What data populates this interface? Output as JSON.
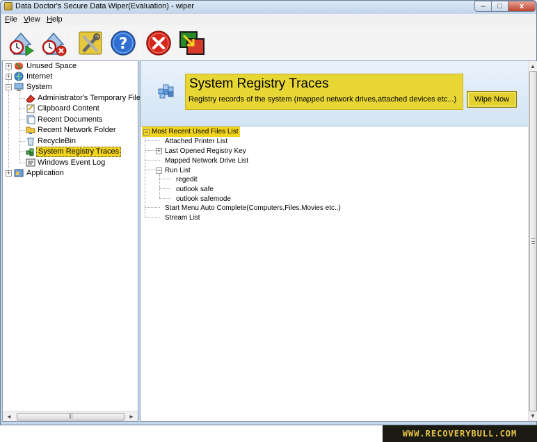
{
  "window": {
    "title": "Data Doctor's Secure Data Wiper(Evaluation) - wiper",
    "controls": {
      "minimize": "–",
      "maximize": "□",
      "close": "x"
    }
  },
  "menu": [
    {
      "label_u": "F",
      "label_rest": "ile"
    },
    {
      "label_u": "V",
      "label_rest": "iew"
    },
    {
      "label_u": "H",
      "label_rest": "elp"
    }
  ],
  "toolbar": {
    "icons": [
      "start-wipe-clock-icon",
      "stop-wipe-clock-icon",
      "tools-settings-icon",
      "help-question-icon",
      "exit-red-x-icon",
      "about-window-icon"
    ]
  },
  "left_tree": {
    "items": [
      {
        "label": "Unused Space",
        "expander": "+",
        "icon": "disk-cleanup-icon"
      },
      {
        "label": "Internet",
        "expander": "+",
        "icon": "globe-icon"
      },
      {
        "label": "System",
        "expander": "−",
        "icon": "computer-icon"
      },
      {
        "label": "Administrator's Temporary Files",
        "icon": "eraser-icon"
      },
      {
        "label": "Clipboard Content",
        "icon": "clipboard-icon"
      },
      {
        "label": "Recent Documents",
        "icon": "documents-icon"
      },
      {
        "label": "Recent Network Folder",
        "icon": "network-folder-icon"
      },
      {
        "label": "RecycleBin",
        "icon": "recycle-bin-icon"
      },
      {
        "label": "System Registry Traces",
        "icon": "registry-icon",
        "selected": true
      },
      {
        "label": "Windows Event Log",
        "icon": "event-log-icon"
      },
      {
        "label": "Application",
        "expander": "+",
        "icon": "application-icon"
      }
    ],
    "hscroll_left": "◄",
    "hscroll_right": "►",
    "hscroll_grip": "|||"
  },
  "banner": {
    "title": "System Registry Traces",
    "subtitle": "Registry records of the system (mapped network drives,attached devices etc...)",
    "button": "Wipe Now"
  },
  "right_tree": {
    "root": "Most Recent Used Files List",
    "items": [
      "Attached Printer List",
      "Last Opened Registry Key",
      "Mapped Network Drive List",
      "Run List",
      "regedit",
      "outlook safe",
      "outlook safemode",
      "Start Menu Auto Complete(Computers,Files.Movies etc..)",
      "Stream List"
    ]
  },
  "vscroll": {
    "up": "▲",
    "down": "▼"
  },
  "footer": {
    "text": "WWW.RECOVERYBULL.COM"
  }
}
